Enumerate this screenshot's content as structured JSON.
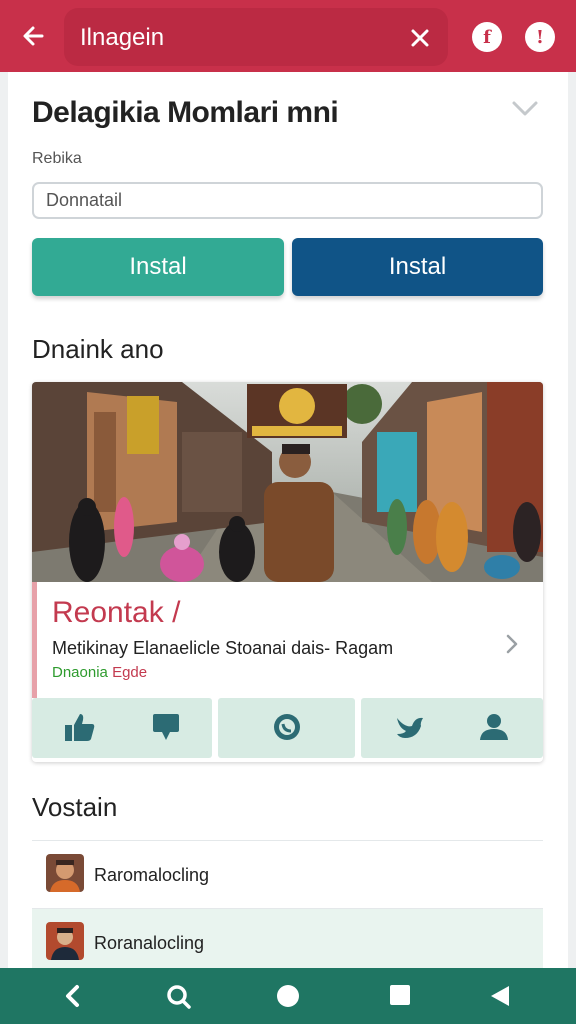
{
  "appbar": {
    "title": "Ilnagein",
    "actions": [
      {
        "icon": "back-arrow-icon"
      },
      {
        "icon": "close-icon"
      },
      {
        "icon": "facebook-icon",
        "glyph": "f"
      },
      {
        "icon": "info-icon",
        "glyph": "!"
      }
    ]
  },
  "form": {
    "heading": "Delagikia Momlari mni",
    "field_label": "Rebika",
    "input_placeholder": "Donnatail",
    "buttons": [
      {
        "label": "Instal",
        "color": "#32aa94"
      },
      {
        "label": "Instal",
        "color": "#105487"
      }
    ]
  },
  "feed": {
    "section_title": "Dnaink ano",
    "post": {
      "image": "village-market-photo",
      "title": "Reontak /",
      "subtitle": "Metikinay Elanaelicle Stoanai dais- Ragam",
      "meta_primary": "Dnaonia",
      "meta_secondary": "Egde",
      "actions": [
        {
          "icon": "thumbs-up-icon"
        },
        {
          "icon": "comment-icon"
        },
        {
          "icon": "whatsapp-icon"
        },
        {
          "icon": "twitter-icon"
        },
        {
          "icon": "user-icon"
        }
      ]
    }
  },
  "list": {
    "section_title": "Vostain",
    "items": [
      {
        "name": "Raromalocling"
      },
      {
        "name": "Roranalocling"
      }
    ]
  },
  "nav": [
    "back-nav-icon",
    "search-nav-icon",
    "home-nav-icon",
    "recents-nav-icon",
    "back-triangle-icon"
  ],
  "colors": {
    "primary": "#c8304a",
    "teal": "#32aa94",
    "blue": "#105487",
    "navbar": "#1f7663",
    "action_bg": "#d7ebe3"
  }
}
